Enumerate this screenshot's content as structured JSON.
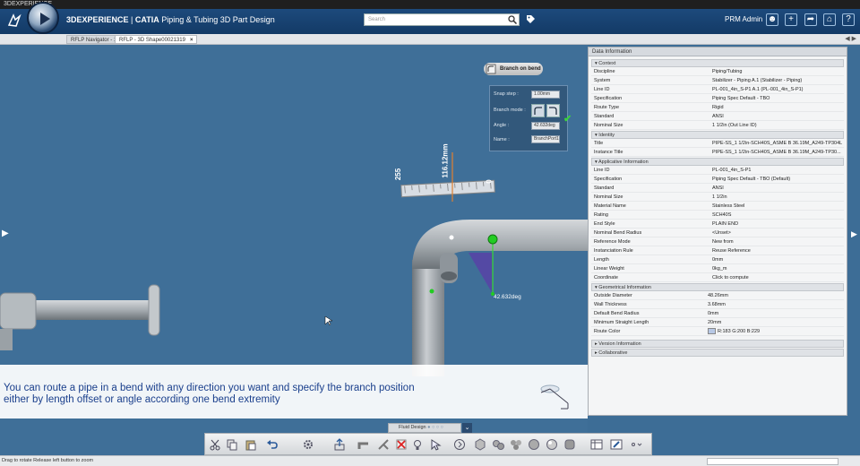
{
  "os": {
    "title": "3DEXPERIENCE"
  },
  "header": {
    "brand": "3DEXPERIENCE",
    "app": "CATIA",
    "app_name": "Piping & Tubing 3D Part Design",
    "search_placeholder": "Search",
    "user": "PRM Admin"
  },
  "tabs": [
    {
      "label": "RFLP Navigator - 1"
    },
    {
      "label": "RFLP - 3D Shape00021319"
    }
  ],
  "viewport": {
    "dim_255": "255",
    "dim_main": "116.12mm",
    "dim_0": "0",
    "angle_label": "42.632deg"
  },
  "branch": {
    "title": "Branch on bend",
    "snap_label": "Snap step :",
    "snap_value": "1.00mm",
    "mode_label": "Branch mode :",
    "angle_label": "Angle :",
    "angle_value": "42.632deg",
    "name_label": "Name :",
    "name_value": "BranchPort1"
  },
  "caption": {
    "line1": "You can route a pipe in a bend with any direction you want and specify the branch position",
    "line2": "either by length offset or angle according one bend extremity"
  },
  "data_panel": {
    "title": "Data Information",
    "sections": {
      "context": "Context",
      "identity": "Identity",
      "applicative": "Applicative Information",
      "geometrical": "Geometrical Information",
      "version": "Version Information",
      "collaborative": "Collaborative"
    },
    "context": [
      {
        "k": "Discipline",
        "v": "Piping/Tubing"
      },
      {
        "k": "System",
        "v": "Stabilizer - Piping A.1 (Stabilizer - Piping)"
      },
      {
        "k": "Line ID",
        "v": "PL-001_4in_S-P1 A.1 (PL-001_4in_S-P1)"
      },
      {
        "k": "Specification",
        "v": "Piping Spec Default - TBO"
      },
      {
        "k": "Route Type",
        "v": "Rigid"
      },
      {
        "k": "Standard",
        "v": "ANSI"
      },
      {
        "k": "Nominal Size",
        "v": "1 1/2in (Out Line ID)"
      }
    ],
    "identity": [
      {
        "k": "Title",
        "v": "PIPE-SS_1 1/2in-SCH40S_ASME B 36.19M_A249-TP304L"
      },
      {
        "k": "Instance Title",
        "v": "PIPE-SS_1 1/2in-SCH40S_ASME B 36.19M_A249-TP30..."
      }
    ],
    "applicative": [
      {
        "k": "Line ID",
        "v": "PL-001_4in_S-P1"
      },
      {
        "k": "Specification",
        "v": "Piping Spec Default - TBO (Default)"
      },
      {
        "k": "Standard",
        "v": "ANSI"
      },
      {
        "k": "Nominal Size",
        "v": "1 1/2in"
      },
      {
        "k": "Material Name",
        "v": "Stainless Steel"
      },
      {
        "k": "Rating",
        "v": "SCH40S"
      },
      {
        "k": "End Style",
        "v": "PLAIN END"
      },
      {
        "k": "Nominal Bend Radius",
        "v": "<Unset>"
      },
      {
        "k": "Reference Mode",
        "v": "New from"
      },
      {
        "k": "Instanciation Rule",
        "v": "Reuse Reference"
      },
      {
        "k": "Length",
        "v": "0mm"
      },
      {
        "k": "Linear Weight",
        "v": "0kg_m"
      },
      {
        "k": "Coordinate",
        "v": "Click to compute"
      }
    ],
    "geometrical": [
      {
        "k": "Outside Diameter",
        "v": "48.26mm"
      },
      {
        "k": "Wall Thickness",
        "v": "3.68mm"
      },
      {
        "k": "Default Bend Radius",
        "v": "0mm"
      },
      {
        "k": "Minimum Straight Length",
        "v": "20mm"
      },
      {
        "k": "Route Color",
        "v": "R:183 G:200 B:229"
      }
    ],
    "route_color": "#b7c8e5"
  },
  "bottom": {
    "fluid_tab": "Fluid Design"
  },
  "status": {
    "text": "Drag to rotate  Release left button to zoom"
  },
  "colors": {
    "accent": "#1d4a7c",
    "caption_text": "#1a3f8c",
    "check": "#3cd43c",
    "handle": "#22cc22"
  }
}
